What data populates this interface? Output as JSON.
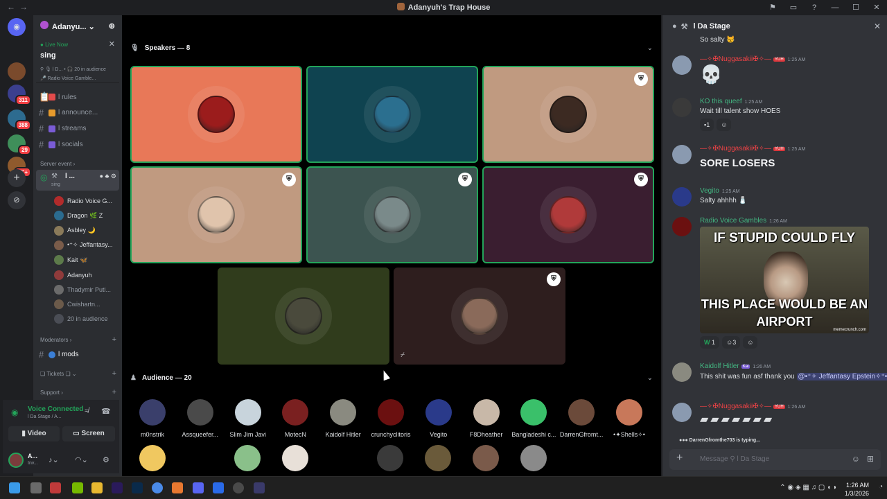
{
  "window": {
    "title": "Adanyuh's Trap House"
  },
  "servers": [
    {
      "label": "",
      "color": "#5865f2"
    },
    {
      "label": "",
      "color": "#7a4a2c"
    },
    {
      "label": "311",
      "color": "#3b3f8f"
    },
    {
      "label": "388",
      "color": "#2d6b8f"
    },
    {
      "label": "29",
      "color": "#3f8f5a"
    },
    {
      "label": "2K+",
      "color": "#8f5a2d"
    }
  ],
  "guild": {
    "name": "Adanyu..."
  },
  "live_now": {
    "label": "Live Now",
    "event": "sing",
    "line1": "⚲ 🎙 l D... • 🎧 20 in audience",
    "line2": "🎤 Radio Voice Gamble..."
  },
  "channels": [
    {
      "icon": "📋",
      "name": "l rules",
      "color": "#e34b4b"
    },
    {
      "icon": "#",
      "name": "l announce...",
      "color": "#e69a2c"
    },
    {
      "icon": "#",
      "name": "l streams",
      "color": "#7a5cd6"
    },
    {
      "icon": "#",
      "name": "l socials",
      "color": "#7a5cd6"
    }
  ],
  "server_event": {
    "label": "Server event"
  },
  "stage_channel": {
    "name": "l ...",
    "sub": "sing"
  },
  "speakers_list": [
    {
      "name": "Radio Voice G...",
      "color": "#b22b2b"
    },
    {
      "name": "Dragon 🌿 Z",
      "color": "#2b6b8f"
    },
    {
      "name": "Asbley 🌙",
      "color": "#8a7a5a"
    },
    {
      "name": "•⁺✧ Jeffantasy...",
      "color": "#7a5c4a"
    },
    {
      "name": "Kait 🦋",
      "color": "#5c7a4a"
    },
    {
      "name": "Adanyuh",
      "color": "#8f3b3b"
    },
    {
      "name": "Thadymir Puti...",
      "color": "#6b6b6b"
    },
    {
      "name": "Cwishartn...",
      "color": "#6b5a4a"
    },
    {
      "name": "20 in audience",
      "color": "#4a4d55"
    }
  ],
  "categories": {
    "moderators": "Moderators",
    "tickets": "❏ Tickets ❏",
    "support": "Support"
  },
  "mods_channel": "l mods",
  "voice": {
    "status": "Voice Connected",
    "channel": "l Da Stage / A...",
    "video": "Video",
    "screen": "Screen"
  },
  "user": {
    "name": "A...",
    "status": "Inv..."
  },
  "stage": {
    "speakers_header": "Speakers — 8",
    "audience_header": "Audience — 20"
  },
  "speaker_tiles": [
    {
      "bg": "#e87858",
      "face": "#9b1c1c",
      "mod": false,
      "border": true
    },
    {
      "bg": "#0f4350",
      "face": "#2b6f8f",
      "mod": false,
      "border": true
    },
    {
      "bg": "#c09a80",
      "face": "#3c2a22",
      "mod": true,
      "border": true
    },
    {
      "bg": "#c09a80",
      "face": "#e0c4ac",
      "mod": true,
      "border": true
    },
    {
      "bg": "#3c5450",
      "face": "#7a8a8a",
      "mod": true,
      "border": true
    },
    {
      "bg": "#3a1e30",
      "face": "#b03a3a",
      "mod": true,
      "border": true
    },
    {
      "bg": "#303c1c",
      "face": "#4a4a3c",
      "mod": false,
      "border": false
    },
    {
      "bg": "#2e1e1e",
      "face": "#8a6a5a",
      "mod": true,
      "border": false
    }
  ],
  "audience": [
    {
      "name": "m0nstrik",
      "color": "#3a3f6b"
    },
    {
      "name": "Assqueefer...",
      "color": "#4a4a4a"
    },
    {
      "name": "Slim Jim Javi",
      "color": "#c8d4dc"
    },
    {
      "name": "MotecN",
      "color": "#7a2020"
    },
    {
      "name": "Kaidolf Hitler",
      "color": "#8a8a80"
    },
    {
      "name": "crunchyclitoris",
      "color": "#6b1010"
    },
    {
      "name": "Vegito",
      "color": "#2a3a8a"
    },
    {
      "name": "F8Dheather",
      "color": "#c8b8a8"
    },
    {
      "name": "Bangladeshi c...",
      "color": "#3ac06a"
    },
    {
      "name": "DarrenGfromt...",
      "color": "#6b4a3a"
    },
    {
      "name": "•✦Shells✧•",
      "color": "#c8785a"
    }
  ],
  "audience_row2": [
    "#f0c860",
    "#8ac08a",
    "#e8e0d8",
    "#3a3a3a",
    "#6a5a3a",
    "#7a5a4a",
    "#8a8a8a"
  ],
  "chat": {
    "header": "l Da Stage",
    "top_text": "So salty 😾",
    "messages": [
      {
        "name": "—✧✠Nuggasakii✠✧—",
        "name_color": "#ed4245",
        "time": "1:25 AM",
        "text": "💀",
        "tag": "YUH"
      },
      {
        "name": "KO this queef",
        "name_color": "#43b581",
        "time": "1:25 AM",
        "text": "Wait till talent show HOES",
        "reaction": "1"
      },
      {
        "name": "—✧✠Nuggasakii✠✧—",
        "name_color": "#ed4245",
        "time": "1:25 AM",
        "text": "SORE LOSERS",
        "tag": "YUH"
      },
      {
        "name": "Vegito",
        "name_color": "#43b581",
        "time": "1:25 AM",
        "text": "Salty ahhhh 🧂"
      },
      {
        "name": "Radio Voice Gambles",
        "name_color": "#43b581",
        "time": "1:26 AM",
        "text": ""
      },
      {
        "name": "Kaidolf Hitler",
        "name_color": "#43b581",
        "time": "1:26 AM",
        "text": "This shit was fun asf thank you",
        "mention": "@•⁺✧ Jeffantasy Epstein✧⁺•",
        "tag2": "Kai"
      },
      {
        "name": "—✧✠Nuggasakii✠✧—",
        "name_color": "#ed4245",
        "time": "1:26 AM",
        "text": "",
        "tag": "YUH"
      }
    ],
    "meme_top": "IF STUPID COULD FLY",
    "meme_bottom": "THIS PLACE WOULD BE AN AIRPORT",
    "meme_watermark": "memecrunch.com",
    "meme_reactions": [
      "1",
      "3"
    ],
    "typing": "DarrenGfromthe703 is typing...",
    "placeholder": "Message ⚲ l Da Stage"
  },
  "taskbar": {
    "time": "1:26 AM",
    "date": "1/3/2026"
  }
}
